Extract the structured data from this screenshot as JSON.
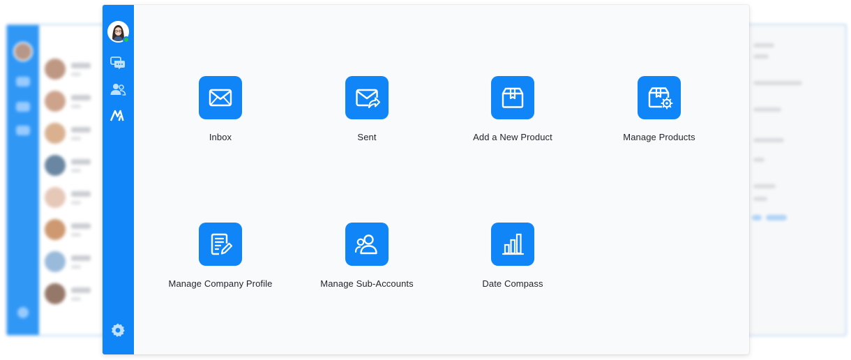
{
  "sidebar": {
    "avatar_icon": "user-avatar",
    "status": "online",
    "icons": [
      "chat-icon",
      "contacts-icon",
      "brand-logo-icon",
      "gear-icon"
    ]
  },
  "tiles": [
    {
      "label": "Inbox",
      "icon": "inbox-icon"
    },
    {
      "label": "Sent",
      "icon": "sent-mail-icon"
    },
    {
      "label": "Add a New Product",
      "icon": "package-add-icon"
    },
    {
      "label": "Manage Products",
      "icon": "package-settings-icon"
    },
    {
      "label": "Manage Company Profile",
      "icon": "document-edit-icon"
    },
    {
      "label": "Manage Sub-Accounts",
      "icon": "users-icon"
    },
    {
      "label": "Date Compass",
      "icon": "bar-chart-icon"
    }
  ],
  "colors": {
    "brand_blue": "#0f85f8",
    "online_green": "#26c443",
    "background": "#f9fafb",
    "text": "#1f2329"
  }
}
